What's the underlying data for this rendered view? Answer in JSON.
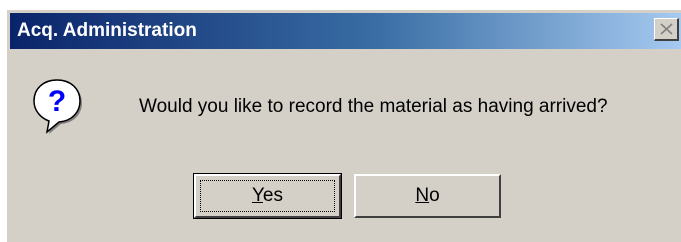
{
  "window": {
    "title": "Acq. Administration",
    "close_icon": "close-icon"
  },
  "dialog": {
    "icon": "question-icon",
    "message": "Would you like to record the material as having arrived?"
  },
  "buttons": {
    "yes": {
      "mnemonic": "Y",
      "rest": "es"
    },
    "no": {
      "mnemonic": "N",
      "rest": "o"
    }
  }
}
